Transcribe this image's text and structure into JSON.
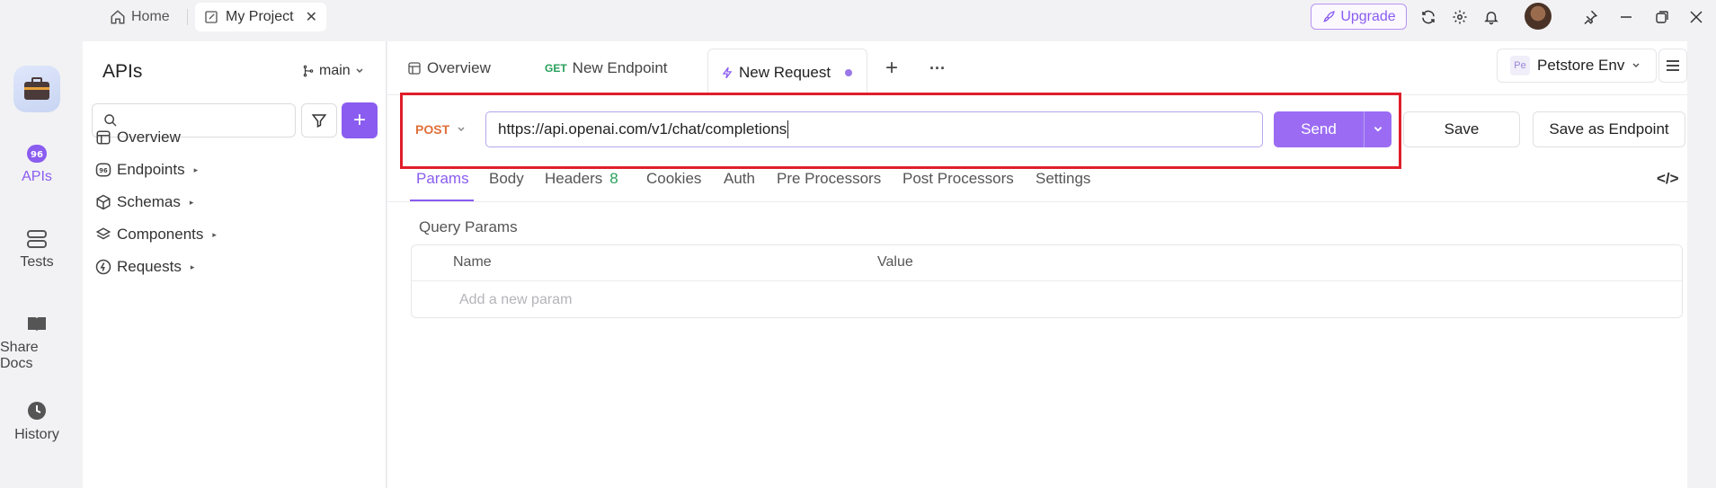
{
  "titlebar": {
    "home_label": "Home",
    "project_tab_label": "My Project",
    "close_glyph": "✕",
    "upgrade_label": "Upgrade"
  },
  "rail": {
    "items": [
      {
        "label": "APIs",
        "icon": "api-icon"
      },
      {
        "label": "Tests",
        "icon": "tests-icon"
      },
      {
        "label": "Share Docs",
        "icon": "book-icon"
      },
      {
        "label": "History",
        "icon": "clock-icon"
      }
    ]
  },
  "sidebar": {
    "title": "APIs",
    "branch": "main",
    "add_glyph": "+",
    "items": [
      {
        "label": "Overview"
      },
      {
        "label": "Endpoints"
      },
      {
        "label": "Schemas"
      },
      {
        "label": "Components"
      },
      {
        "label": "Requests"
      }
    ],
    "caret_glyph": "▸"
  },
  "main": {
    "tabs": [
      {
        "label": "Overview"
      },
      {
        "method": "GET",
        "label": "New Endpoint"
      },
      {
        "label": "New Request"
      }
    ],
    "add_tab_glyph": "+",
    "more_glyph": "···",
    "environment": {
      "badge": "Pe",
      "label": "Petstore Env"
    }
  },
  "request": {
    "method": "POST",
    "url": "https://api.openai.com/v1/chat/completions",
    "send_label": "Send",
    "save_label": "Save",
    "save_endpoint_label": "Save as Endpoint"
  },
  "subtabs": {
    "items": [
      "Params",
      "Body",
      "Headers",
      "Cookies",
      "Auth",
      "Pre Processors",
      "Post Processors",
      "Settings"
    ],
    "headers_count": "8",
    "code_glyph": "</>"
  },
  "params": {
    "section_label": "Query Params",
    "columns": [
      "Name",
      "Value"
    ],
    "add_placeholder": "Add a new param"
  },
  "colors": {
    "accent": "#8a5cf0",
    "post_method": "#e0703a",
    "get_method": "#27a05a",
    "highlight_box": "#e01e2a"
  }
}
